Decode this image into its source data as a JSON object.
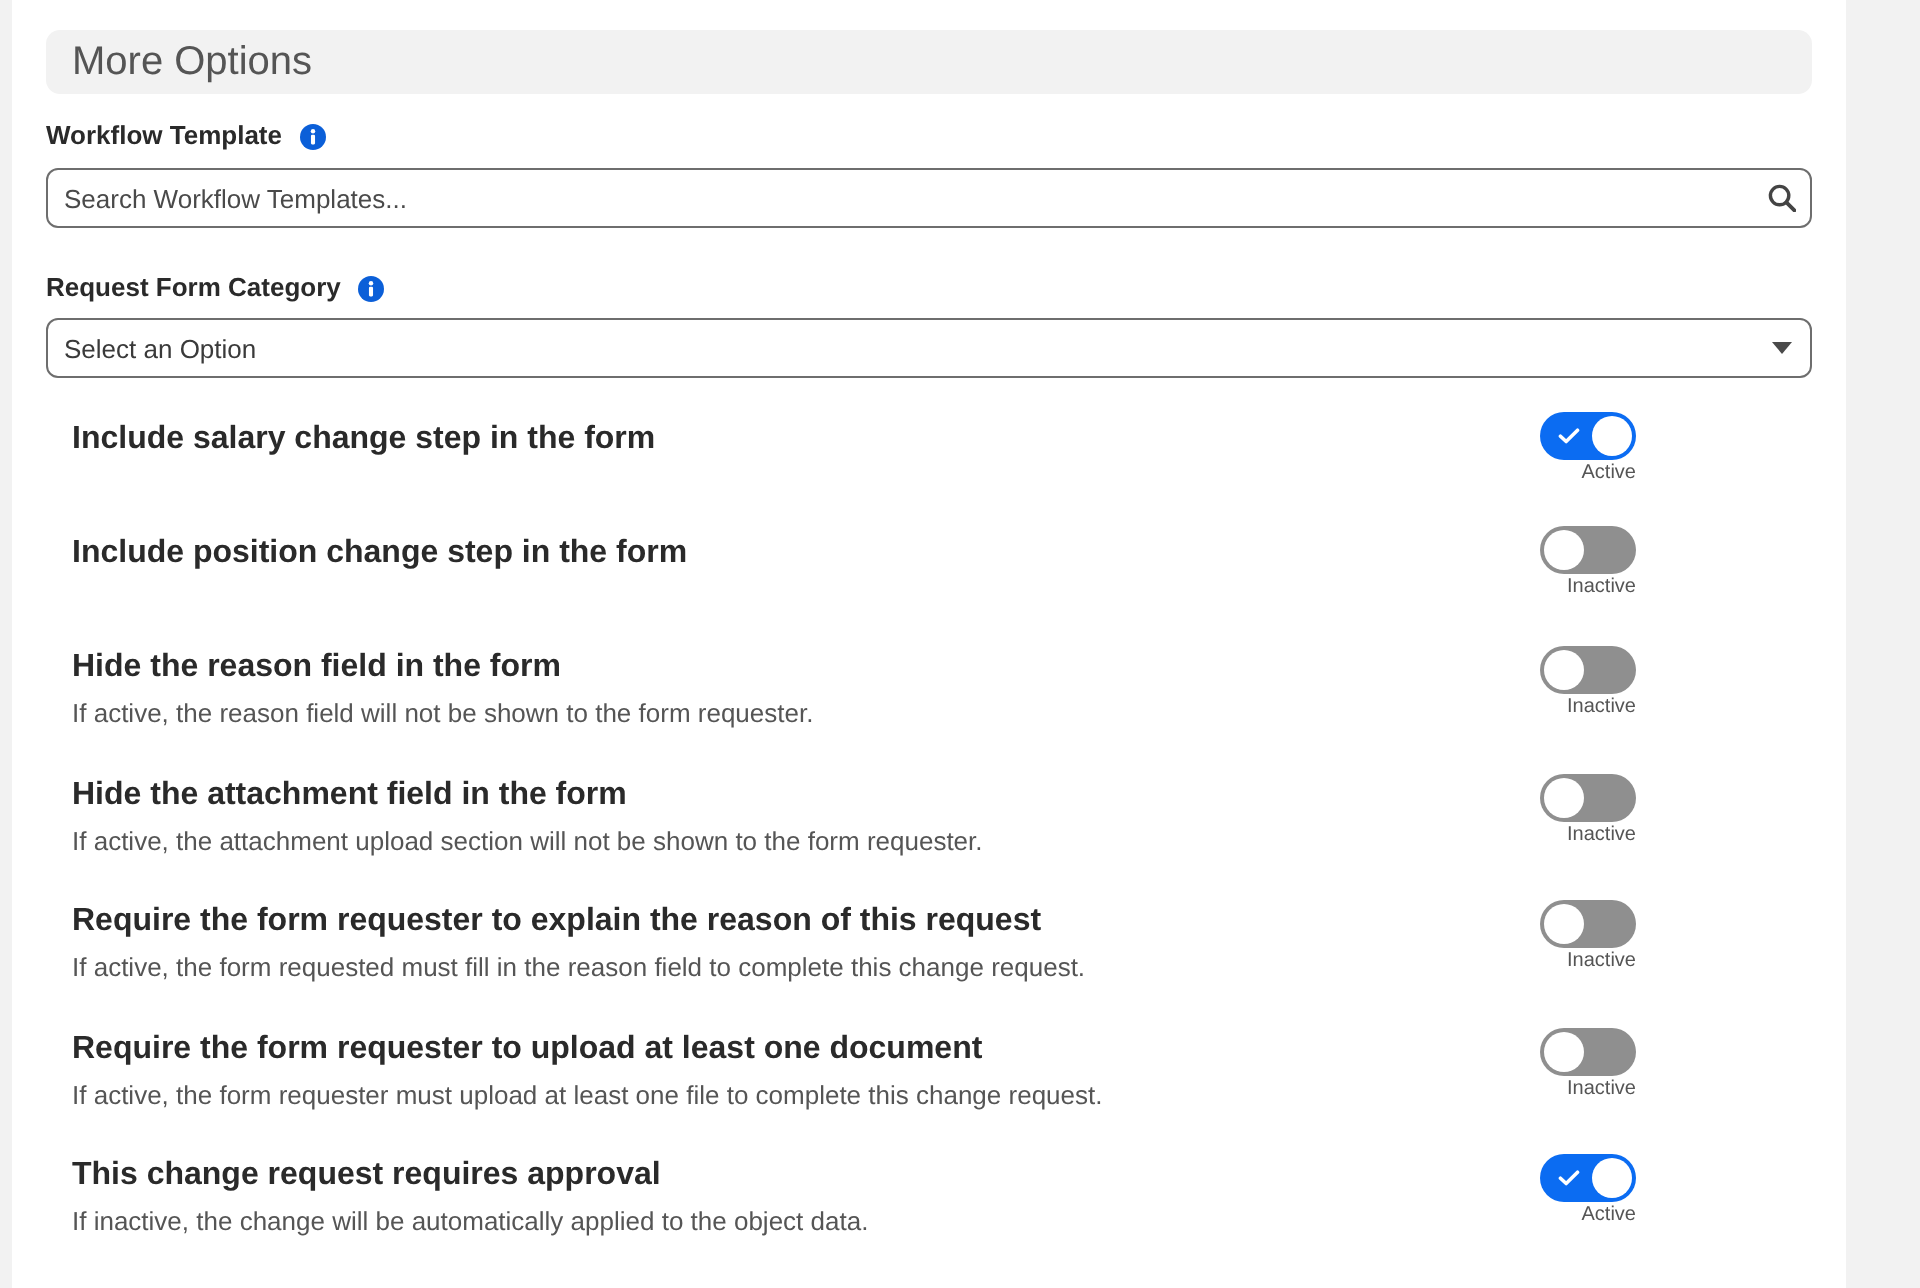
{
  "section": {
    "title": "More Options"
  },
  "fields": [
    {
      "kind": "search",
      "label": "Workflow Template",
      "placeholder": "Search Workflow Templates..."
    },
    {
      "kind": "select",
      "label": "Request Form Category",
      "placeholder": "Select an Option"
    }
  ],
  "settings": [
    {
      "title": "Include salary change step in the form",
      "on": true,
      "status": "Active"
    },
    {
      "title": "Include position change step in the form",
      "on": false,
      "status": "Inactive"
    },
    {
      "title": "Hide the reason field in the form",
      "description": "If active, the reason field will not be shown to the form requester.",
      "on": false,
      "status": "Inactive"
    },
    {
      "title": "Hide the attachment field in the form",
      "description": "If active, the attachment upload section will not be shown to the form requester.",
      "on": false,
      "status": "Inactive"
    },
    {
      "title": "Require the form requester to explain the reason of this request",
      "description": "If active, the form requested must fill in the reason field to complete this change request.",
      "on": false,
      "status": "Inactive"
    },
    {
      "title": "Require the form requester to upload at least one document",
      "description": "If active, the form requester must upload at least one file to complete this change request.",
      "on": false,
      "status": "Inactive"
    },
    {
      "title": "This change request requires approval",
      "description": "If inactive, the change will be automatically applied to the object data.",
      "on": true,
      "status": "Active"
    }
  ]
}
